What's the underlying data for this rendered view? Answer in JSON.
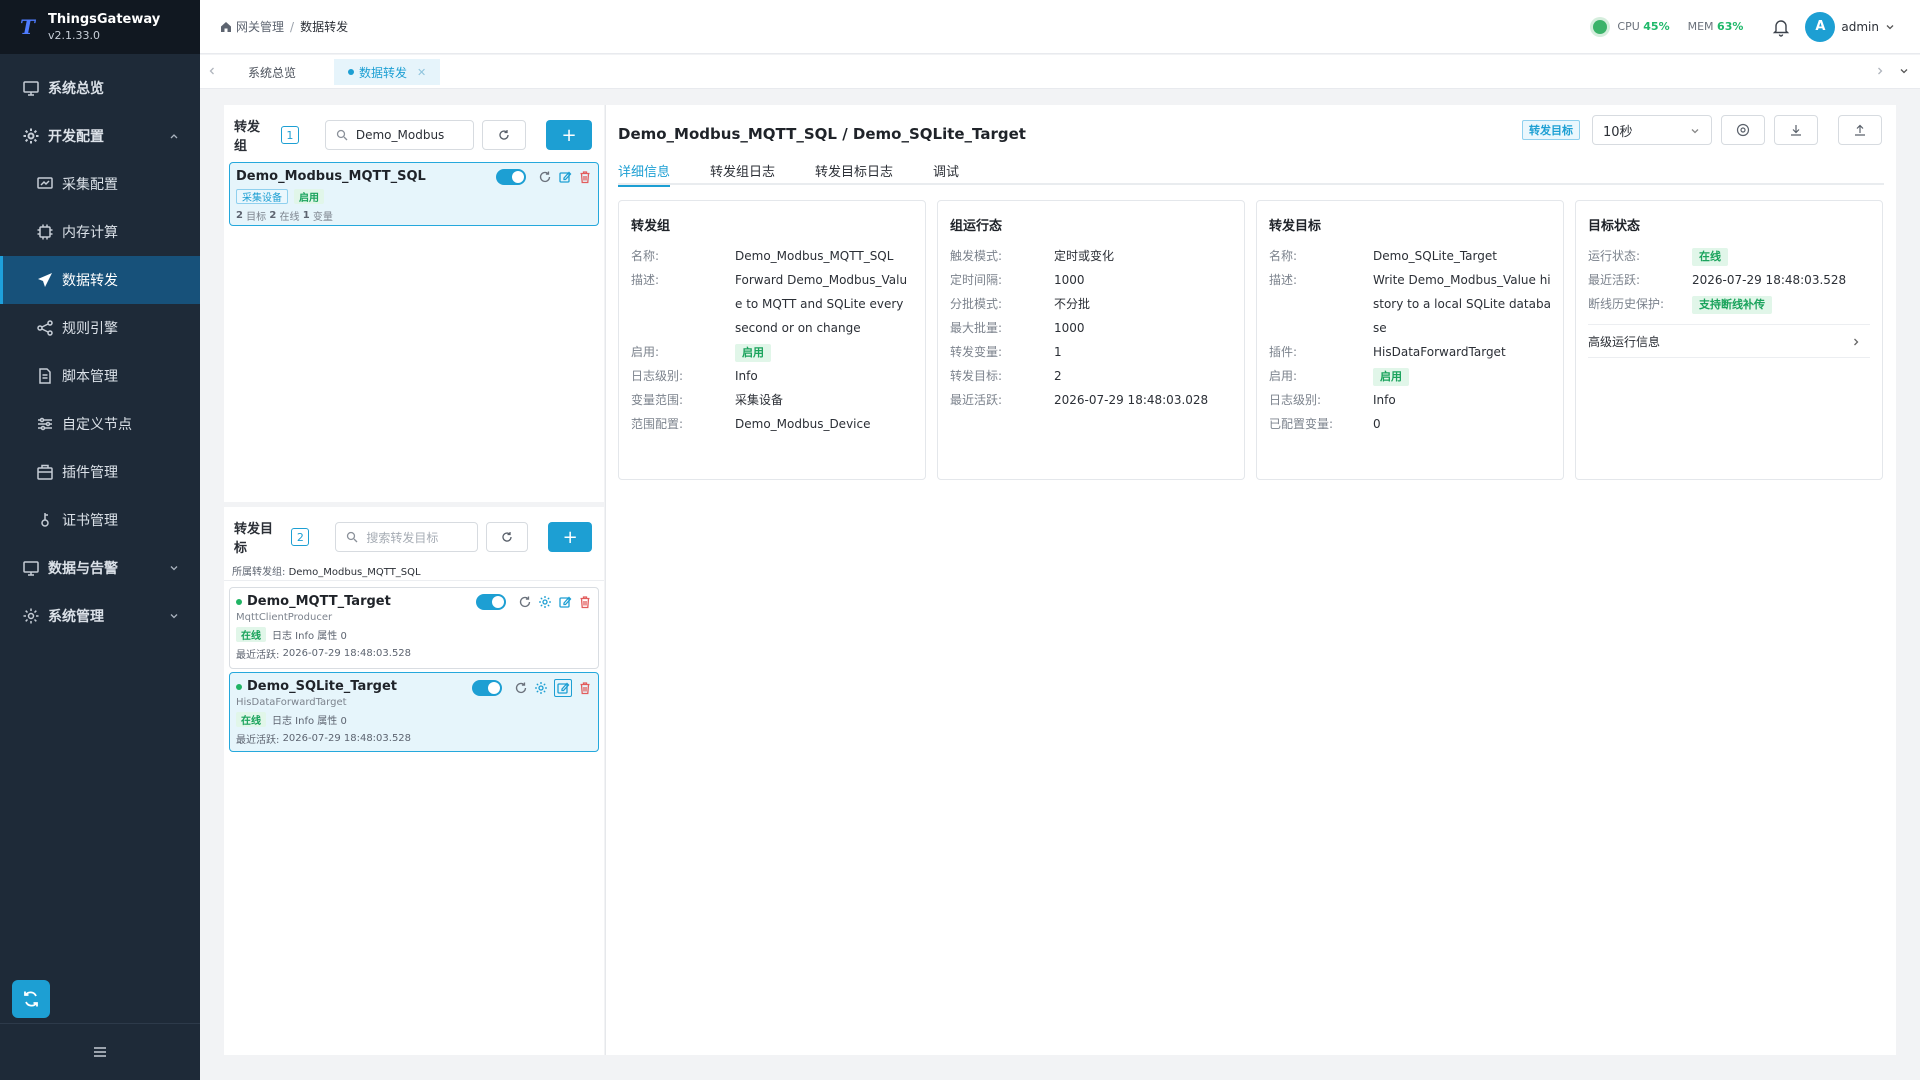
{
  "app": {
    "title": "ThingsGateway",
    "version": "v2.1.33.0",
    "logo_letter": "T"
  },
  "sidebar": {
    "items": [
      {
        "label": "系统总览",
        "icon": "monitor-icon"
      },
      {
        "label": "开发配置",
        "icon": "gear-icon",
        "expanded": true
      },
      {
        "label": "采集配置",
        "icon": "collect-icon"
      },
      {
        "label": "内存计算",
        "icon": "chip-icon"
      },
      {
        "label": "数据转发",
        "icon": "send-icon",
        "active": true
      },
      {
        "label": "规则引擎",
        "icon": "share-icon"
      },
      {
        "label": "脚本管理",
        "icon": "file-icon"
      },
      {
        "label": "自定义节点",
        "icon": "sliders-icon"
      },
      {
        "label": "插件管理",
        "icon": "plugin-icon"
      },
      {
        "label": "证书管理",
        "icon": "cert-icon"
      },
      {
        "label": "数据与告警",
        "icon": "monitor-icon"
      },
      {
        "label": "系统管理",
        "icon": "gear-icon"
      }
    ]
  },
  "header": {
    "breadcrumb": [
      "网关管理",
      "数据转发"
    ],
    "cpu_label": "CPU",
    "cpu_value": "45%",
    "mem_label": "MEM",
    "mem_value": "63%",
    "user_initial": "A",
    "user_name": "admin"
  },
  "tabs": [
    {
      "label": "系统总览"
    },
    {
      "label": "数据转发",
      "active": true
    }
  ],
  "groups": {
    "title": "转发组",
    "count": "1",
    "search_value": "Demo_Modbus",
    "items": [
      {
        "name": "Demo_Modbus_MQTT_SQL",
        "tag_source": "采集设备",
        "tag_state": "启用",
        "targets_n": "2",
        "targets_l": "目标",
        "online_n": "2",
        "online_l": "在线",
        "vars_n": "1",
        "vars_l": "变量"
      }
    ]
  },
  "targets": {
    "title": "转发目标",
    "count": "2",
    "search_placeholder": "搜索转发目标",
    "owner_label": "所属转发组:",
    "owner_value": "Demo_Modbus_MQTT_SQL",
    "items": [
      {
        "name": "Demo_MQTT_Target",
        "plugin": "MqttClientProducer",
        "state": "在线",
        "meta": "日志 Info 属性 0",
        "last_label": "最近活跃:",
        "last_value": "2026-07-29 18:48:03.528"
      },
      {
        "name": "Demo_SQLite_Target",
        "plugin": "HisDataForwardTarget",
        "state": "在线",
        "meta": "日志 Info 属性 0",
        "last_label": "最近活跃:",
        "last_value": "2026-07-29 18:48:03.528"
      }
    ]
  },
  "detail": {
    "title": "Demo_Modbus_MQTT_SQL / Demo_SQLite_Target",
    "tag": "转发目标",
    "interval": "10秒",
    "tabs": [
      "详细信息",
      "转发组日志",
      "转发目标日志",
      "调试"
    ],
    "group_card": {
      "title": "转发组",
      "rows": [
        {
          "k": "名称:",
          "v": "Demo_Modbus_MQTT_SQL"
        },
        {
          "k": "描述:",
          "v": "Forward Demo_Modbus_Value to MQTT and SQLite every second or on change"
        },
        {
          "k": "启用:",
          "v": "启用"
        },
        {
          "k": "日志级别:",
          "v": "Info"
        },
        {
          "k": "变量范围:",
          "v": "采集设备"
        },
        {
          "k": "范围配置:",
          "v": "Demo_Modbus_Device"
        }
      ]
    },
    "run_card": {
      "title": "组运行态",
      "rows": [
        {
          "k": "触发模式:",
          "v": "定时或变化"
        },
        {
          "k": "定时间隔:",
          "v": "1000"
        },
        {
          "k": "分批模式:",
          "v": "不分批"
        },
        {
          "k": "最大批量:",
          "v": "1000"
        },
        {
          "k": "转发变量:",
          "v": "1"
        },
        {
          "k": "转发目标:",
          "v": "2"
        },
        {
          "k": "最近活跃:",
          "v": "2026-07-29 18:48:03.028"
        }
      ]
    },
    "target_card": {
      "title": "转发目标",
      "rows": [
        {
          "k": "名称:",
          "v": "Demo_SQLite_Target"
        },
        {
          "k": "描述:",
          "v": "Write Demo_Modbus_Value history to a local SQLite database"
        },
        {
          "k": "插件:",
          "v": "HisDataForwardTarget"
        },
        {
          "k": "启用:",
          "v": "启用"
        },
        {
          "k": "日志级别:",
          "v": "Info"
        },
        {
          "k": "已配置变量:",
          "v": "0"
        }
      ]
    },
    "status_card": {
      "title": "目标状态",
      "rows": [
        {
          "k": "运行状态:",
          "v": "在线"
        },
        {
          "k": "最近活跃:",
          "v": "2026-07-29 18:48:03.528"
        },
        {
          "k": "断线历史保护:",
          "v": "支持断线补传"
        }
      ],
      "advanced": "高级运行信息"
    }
  }
}
